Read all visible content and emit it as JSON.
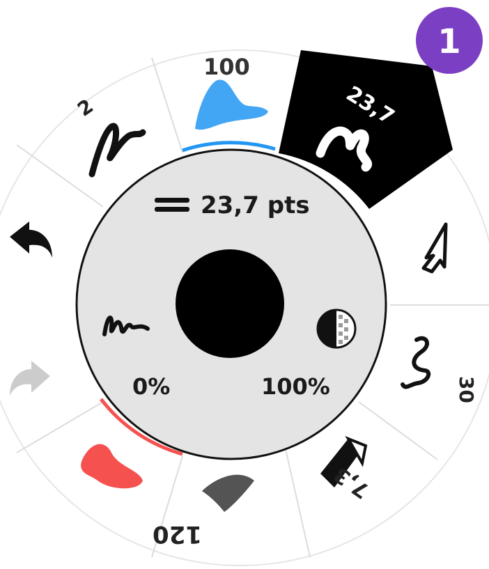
{
  "badge": {
    "text": "1",
    "color": "#7b3fc4"
  },
  "center": {
    "size_text": "23,7 pts",
    "smoothing_text": "0%",
    "opacity_text": "100%",
    "color": "#000000"
  },
  "segments": {
    "flow": {
      "label": "100",
      "color": "#2196f3"
    },
    "size": {
      "label": "23,7"
    },
    "pencil": {
      "label": "2"
    },
    "stabilizer": {
      "label": "30"
    },
    "shape": {
      "label": "7,3"
    },
    "blur": {
      "label": "120"
    },
    "eraser": {
      "color": "#f5514e"
    }
  },
  "side_actions": {
    "undo_enabled": true,
    "redo_enabled": false
  },
  "colors": {
    "ring_bg": "#ffffff",
    "center_bg": "#e4e4e4",
    "divider": "#dddddd",
    "selected_bg": "#000000",
    "accent_blue": "#2196f3",
    "accent_red": "#f5514e",
    "disabled": "#cccccc"
  }
}
